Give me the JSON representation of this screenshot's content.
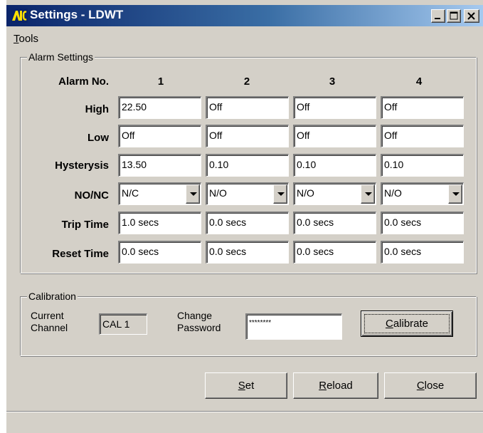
{
  "window": {
    "title": "Settings - LDWT"
  },
  "menu": {
    "tools": {
      "mnemonic": "T",
      "rest": "ools"
    }
  },
  "alarm": {
    "legend": "Alarm Settings",
    "header_label": "Alarm No.",
    "columns": [
      "1",
      "2",
      "3",
      "4"
    ],
    "rows": {
      "high": {
        "label": "High",
        "values": [
          "22.50",
          "Off",
          "Off",
          "Off"
        ]
      },
      "low": {
        "label": "Low",
        "values": [
          "Off",
          "Off",
          "Off",
          "Off"
        ]
      },
      "hysterysis": {
        "label": "Hysterysis",
        "values": [
          "13.50",
          "0.10",
          "0.10",
          "0.10"
        ]
      },
      "nonc": {
        "label": "NO/NC",
        "values": [
          "N/C",
          "N/O",
          "N/O",
          "N/O"
        ]
      },
      "trip_time": {
        "label": "Trip Time",
        "values": [
          "1.0 secs",
          "0.0 secs",
          "0.0 secs",
          "0.0 secs"
        ]
      },
      "reset_time": {
        "label": "Reset Time",
        "values": [
          "0.0 secs",
          "0.0 secs",
          "0.0 secs",
          "0.0 secs"
        ]
      }
    }
  },
  "calibration": {
    "legend": "Calibration",
    "current_channel_label_1": "Current",
    "current_channel_label_2": "Channel",
    "current_channel_value": "CAL 1",
    "change_password_label_1": "Change",
    "change_password_label_2": "Password",
    "password_value": "********",
    "calibrate_button": {
      "mnemonic": "C",
      "rest": "alibrate"
    }
  },
  "buttons": {
    "set": {
      "mnemonic": "S",
      "rest": "et"
    },
    "reload": {
      "mnemonic": "R",
      "rest": "eload"
    },
    "close": {
      "mnemonic": "C",
      "rest": "lose"
    }
  },
  "colors": {
    "face": "#d4d0c8",
    "title_start": "#0a246a",
    "title_end": "#a6caf0"
  }
}
